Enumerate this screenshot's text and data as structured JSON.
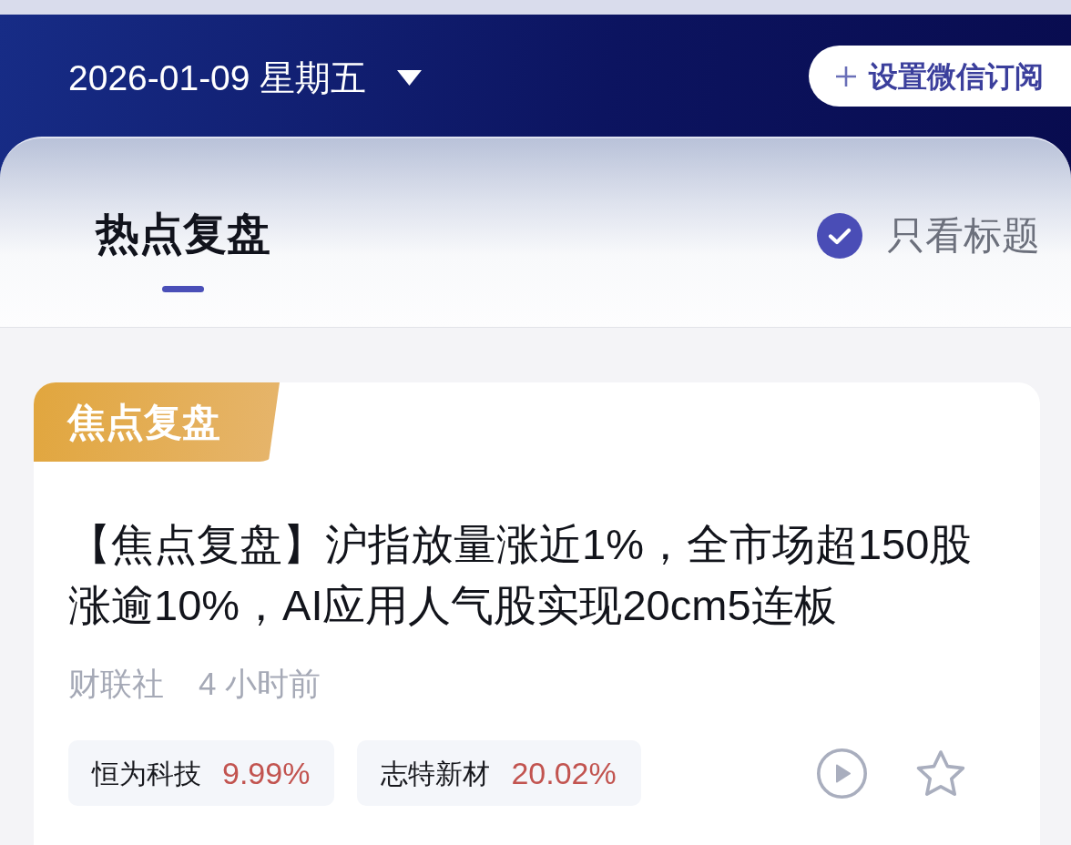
{
  "top_bar": {
    "date": "2026-01-09 星期五",
    "subscribe_button": {
      "label": "设置微信订阅"
    }
  },
  "tabs": [
    {
      "label": "热点复盘",
      "selected": true
    }
  ],
  "title_only_toggle": {
    "label": "只看标题",
    "checked": true
  },
  "articles": [
    {
      "tag": "焦点复盘",
      "headline": "【焦点复盘】沪指放量涨近1%，全市场超150股涨逾10%，AI应用人气股实现20cm5连板",
      "source": "财联社",
      "time": "4 小时前",
      "stocks": [
        {
          "name": "恒为科技",
          "change": "9.99%"
        },
        {
          "name": "志特新材",
          "change": "20.02%"
        }
      ],
      "favorited": false
    }
  ]
}
